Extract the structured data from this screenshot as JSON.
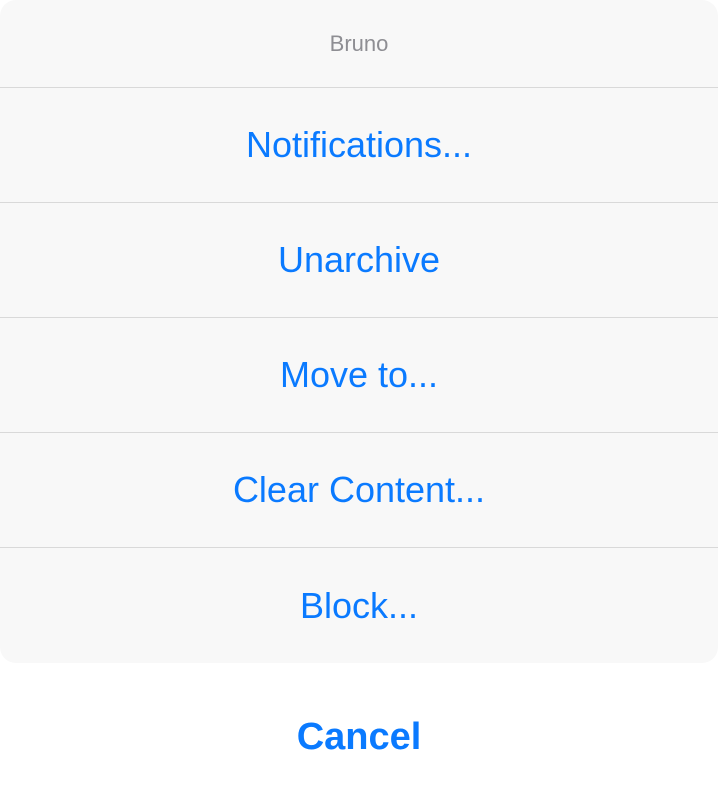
{
  "sheet": {
    "title": "Bruno",
    "actions": [
      {
        "label": "Notifications..."
      },
      {
        "label": "Unarchive"
      },
      {
        "label": "Move to..."
      },
      {
        "label": "Clear Content..."
      },
      {
        "label": "Block..."
      }
    ]
  },
  "cancel_label": "Cancel",
  "colors": {
    "accent": "#0a7aff",
    "title": "#8e8e93",
    "sheet_background": "#f8f8f8",
    "separator": "#d9d9d9"
  }
}
